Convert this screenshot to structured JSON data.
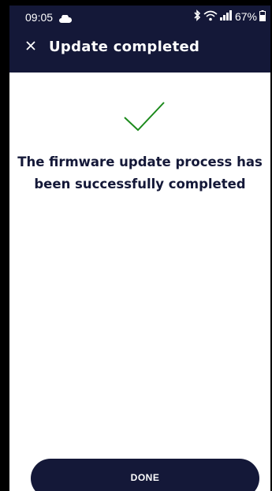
{
  "status_bar": {
    "time": "09:05",
    "battery_percent": "67%",
    "icons": [
      "cloud-icon",
      "bluetooth-icon",
      "wifi-icon",
      "signal-icon",
      "battery-icon"
    ]
  },
  "header": {
    "title": "Update completed",
    "close_icon": "close-icon"
  },
  "main": {
    "status_icon": "checkmark-icon",
    "message": "The firmware update process has been successfully completed"
  },
  "footer": {
    "done_label": "DONE"
  },
  "colors": {
    "primary": "#141838",
    "success": "#1b8a1b",
    "background": "#ffffff"
  }
}
